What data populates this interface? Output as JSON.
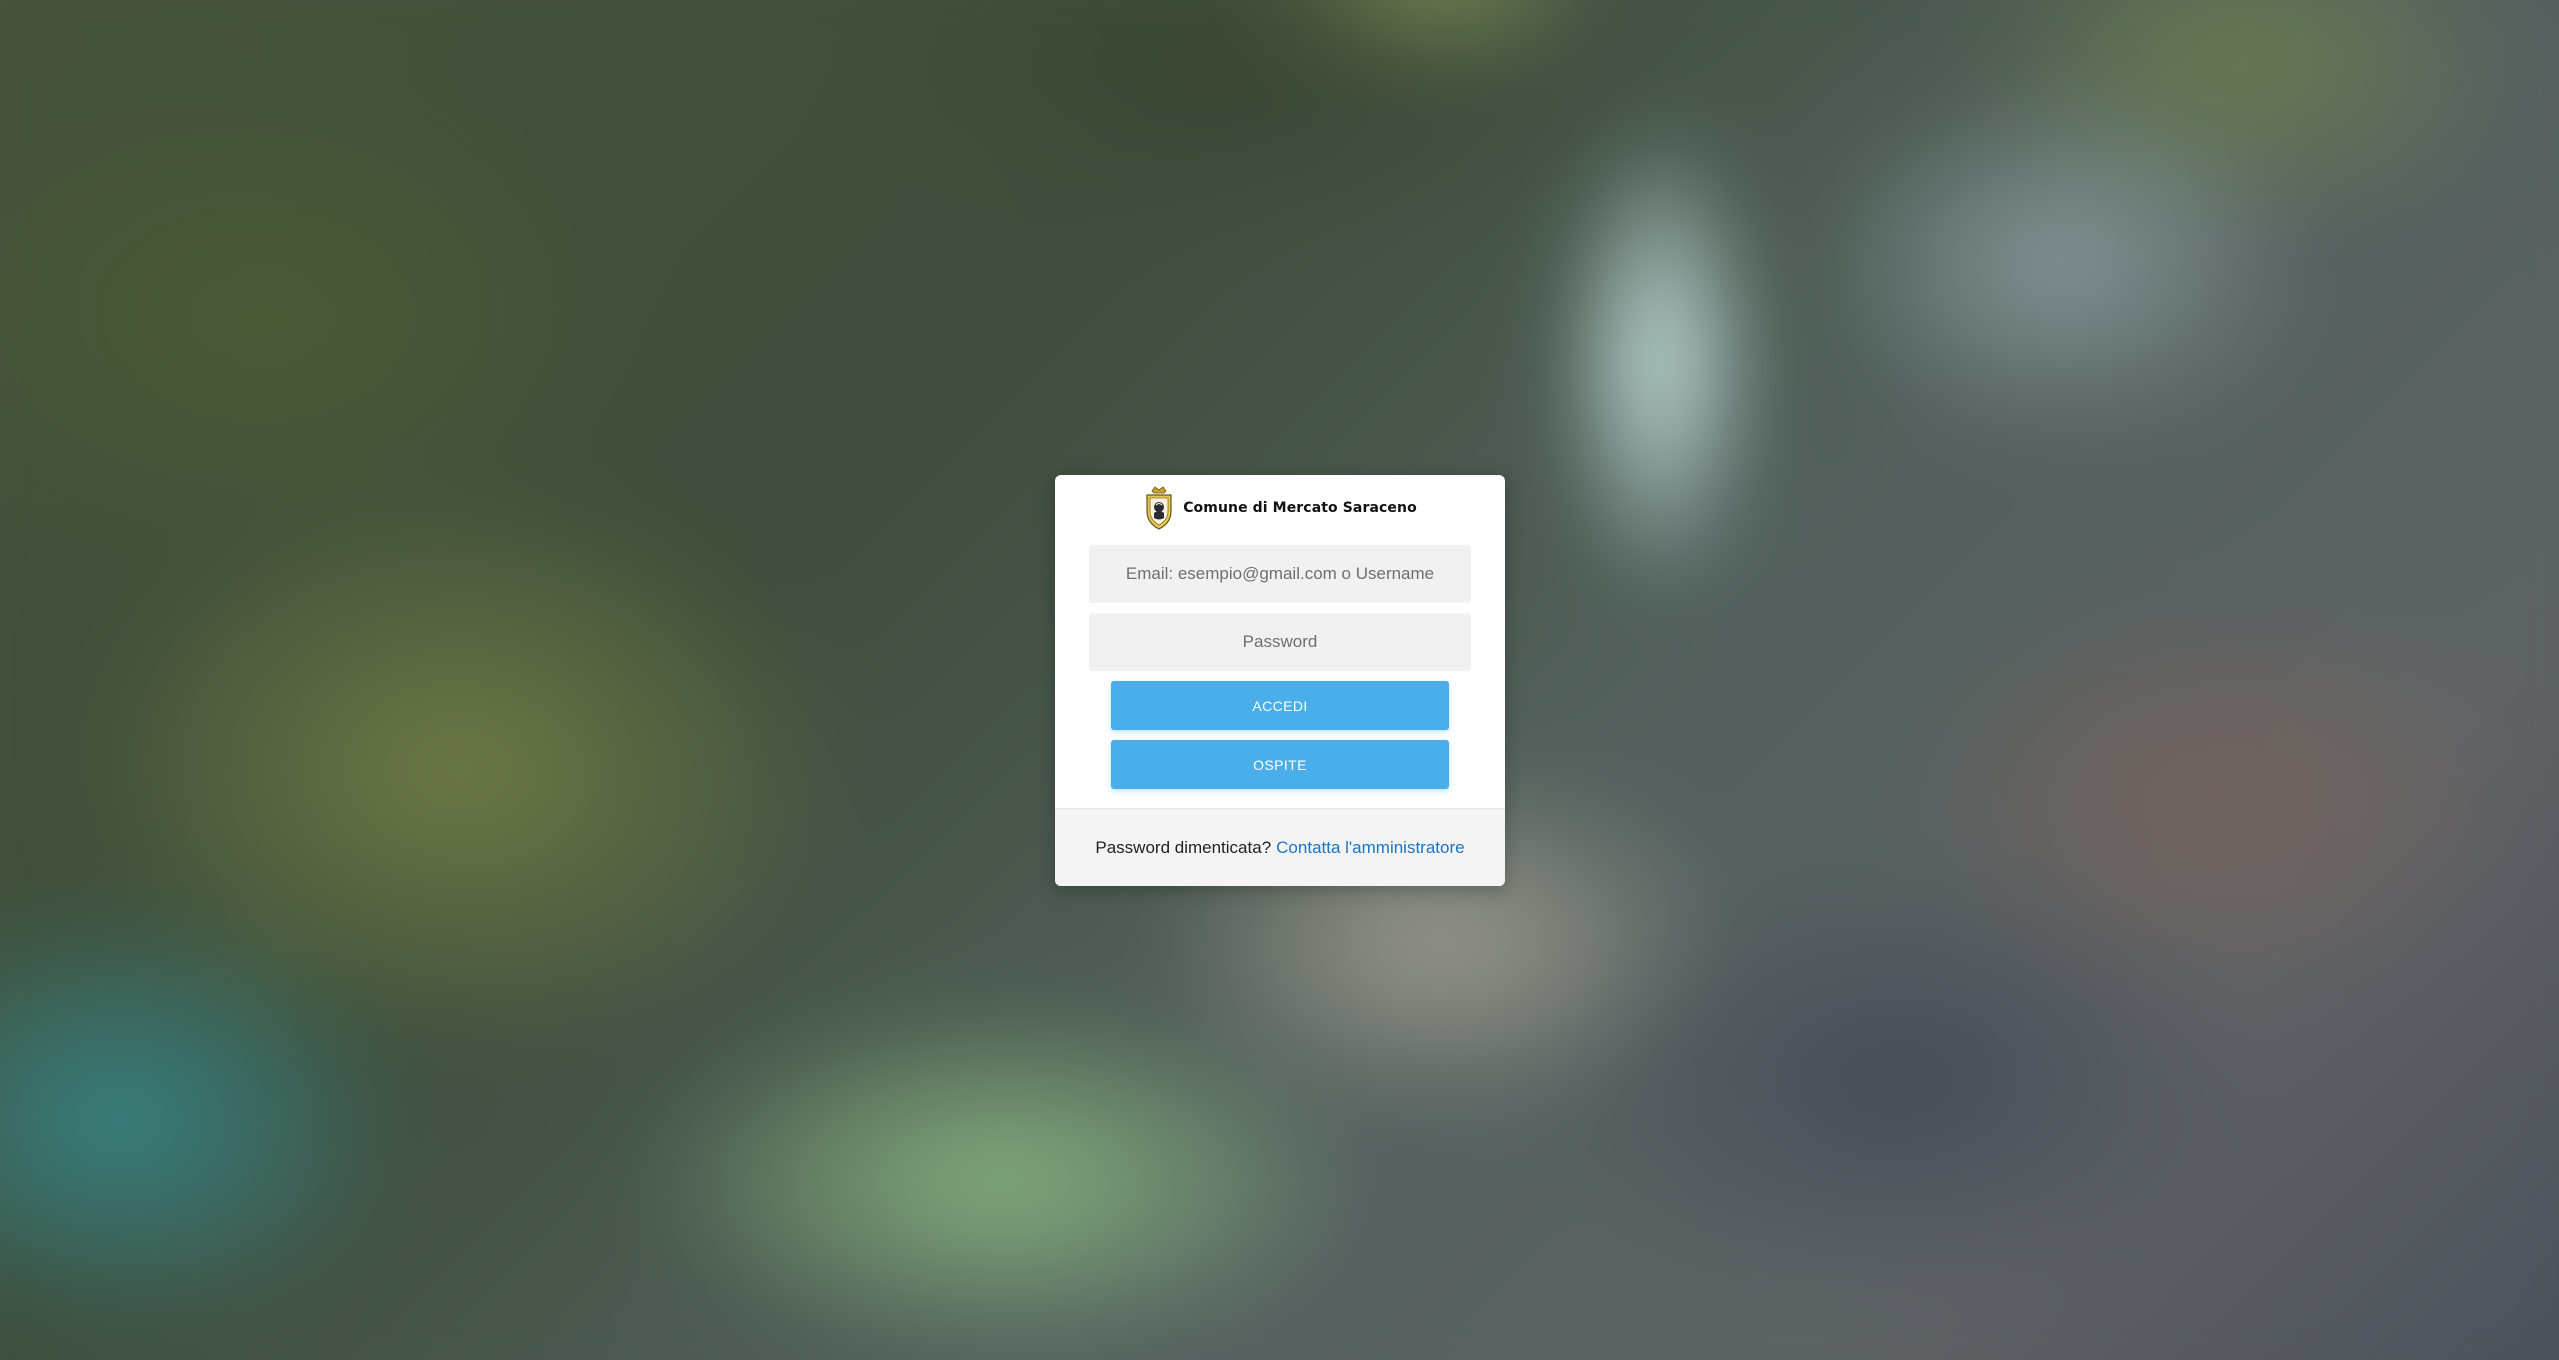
{
  "background": {
    "description_icon": "blurred-aerial-photo"
  },
  "brand": {
    "logo_icon": "municipal-crest-icon",
    "name": "Comune di Mercato Saraceno"
  },
  "form": {
    "email_placeholder": "Email: esempio@gmail.com o Username",
    "email_value": "",
    "password_placeholder": "Password",
    "password_value": "",
    "login_label": "ACCEDI",
    "guest_label": "OSPITE"
  },
  "footer": {
    "question": "Password dimenticata?",
    "contact_link": "Contatta l'amministratore"
  },
  "colors": {
    "button_primary": "#49aeea",
    "link": "#1d74c4",
    "input_background": "#f1f1f1"
  }
}
